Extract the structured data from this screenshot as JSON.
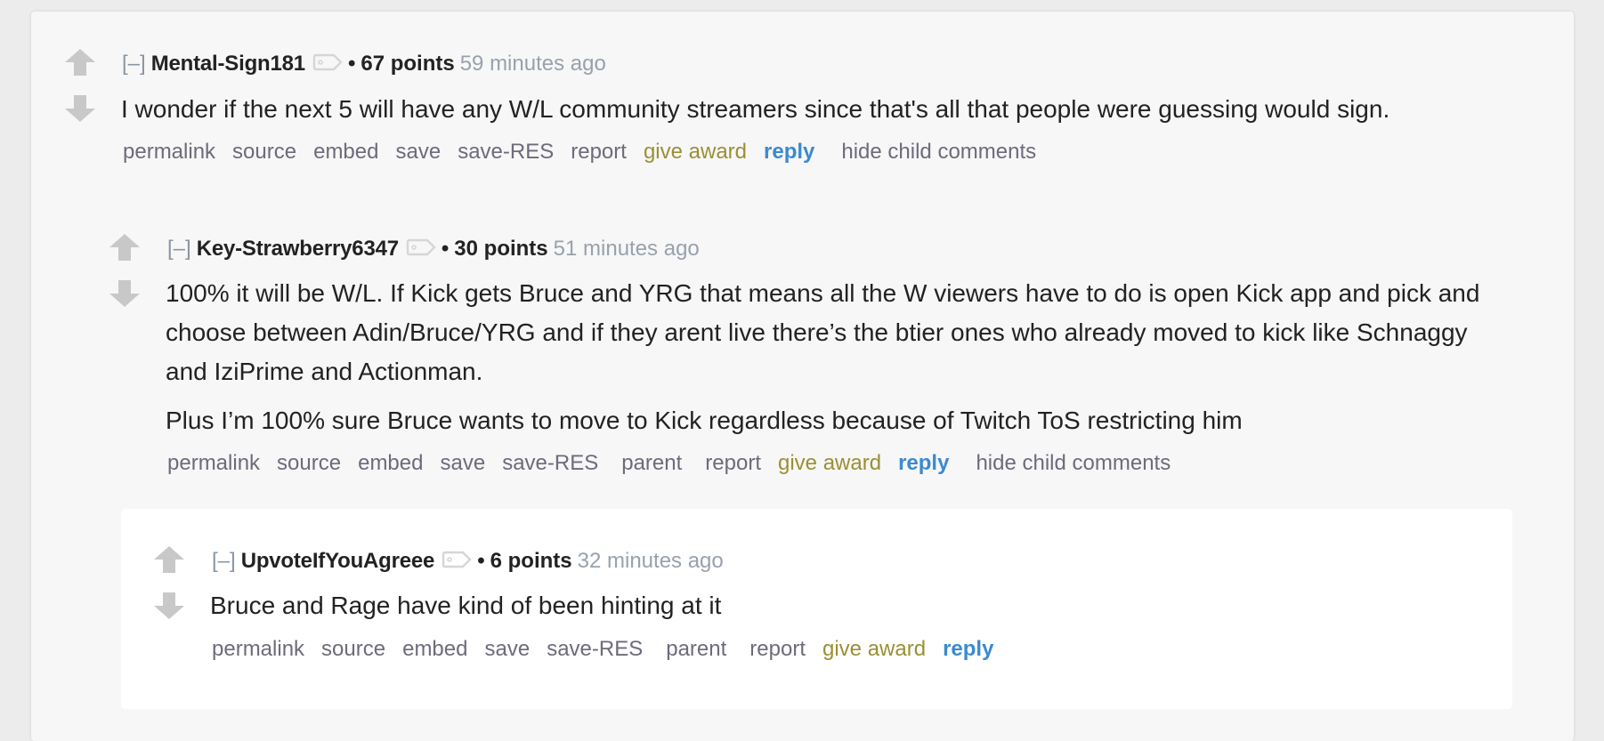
{
  "colors": {
    "page_background": "#ececec",
    "panel_background": "#f7f7f7",
    "nested_background": "#ffffff",
    "author": "#222222",
    "timestamp": "#98a1ad",
    "action_link": "#6f6a7c",
    "give_award": "#9b8f34",
    "reply": "#3a8ad0",
    "vote_arrow": "#c8c8c8"
  },
  "comments": [
    {
      "collapse_label": "[–]",
      "author": "Mental-Sign181",
      "tag_icon": "tag-icon",
      "bullet": "•",
      "score": "67 points",
      "time": "59 minutes ago",
      "paragraphs": [
        "I wonder if the next 5 will have any W/L community streamers since that's all that people were guessing would sign."
      ],
      "actions": {
        "permalink": "permalink",
        "source": "source",
        "embed": "embed",
        "save": "save",
        "save_res": "save-RES",
        "report": "report",
        "give_award": "give award",
        "reply": "reply",
        "hide_child": "hide child comments"
      }
    },
    {
      "collapse_label": "[–]",
      "author": "Key-Strawberry6347",
      "tag_icon": "tag-icon",
      "bullet": "•",
      "score": "30 points",
      "time": "51 minutes ago",
      "paragraphs": [
        "100% it will be W/L. If Kick gets Bruce and YRG that means all the W viewers have to do is open Kick app and pick and choose between Adin/Bruce/YRG and if they arent live there’s the btier ones who already moved to kick like Schnaggy and IziPrime and Actionman.",
        "Plus I’m 100% sure Bruce wants to move to Kick regardless because of Twitch ToS restricting him"
      ],
      "actions": {
        "permalink": "permalink",
        "source": "source",
        "embed": "embed",
        "save": "save",
        "save_res": "save-RES",
        "parent": "parent",
        "report": "report",
        "give_award": "give award",
        "reply": "reply",
        "hide_child": "hide child comments"
      }
    },
    {
      "collapse_label": "[–]",
      "author": "UpvoteIfYouAgreee",
      "tag_icon": "tag-icon",
      "bullet": "•",
      "score": "6 points",
      "time": "32 minutes ago",
      "paragraphs": [
        "Bruce and Rage have kind of been hinting at it"
      ],
      "actions": {
        "permalink": "permalink",
        "source": "source",
        "embed": "embed",
        "save": "save",
        "save_res": "save-RES",
        "parent": "parent",
        "report": "report",
        "give_award": "give award",
        "reply": "reply"
      }
    }
  ]
}
